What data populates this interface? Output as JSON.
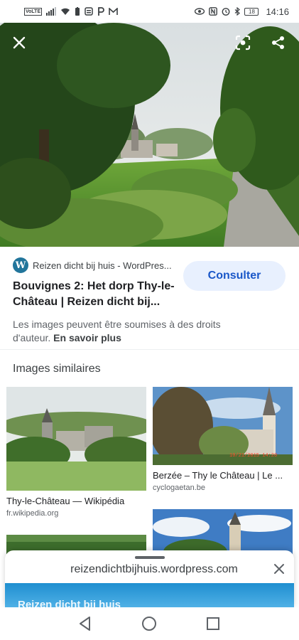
{
  "status_bar": {
    "volte": "VoLTE",
    "battery": "18",
    "time": "14:16"
  },
  "hero": {
    "close_icon": "close-icon",
    "lens_icon": "lens-icon",
    "share_icon": "share-icon"
  },
  "result": {
    "source": "Reizen dicht bij huis - WordPres...",
    "consult_label": "Consulter",
    "title": "Bouvignes 2: Het dorp Thy-le-Château | Reizen dicht bij...",
    "copyright_text": "Les images peuvent être soumises à des droits d'auteur.",
    "learn_more": "En savoir plus"
  },
  "similar": {
    "heading": "Images similaires",
    "cards": [
      {
        "title": "Thy-le-Château — Wikipédia",
        "domain": "fr.wikipedia.org"
      },
      {
        "title": "Berzée – Thy le Château | Le ...",
        "domain": "cyclogaetan.be"
      }
    ]
  },
  "sheet": {
    "url": "reizendichtbijhuis.wordpress.com",
    "preview_title": "Reizen dicht bij huis"
  },
  "colors": {
    "accent": "#1a57c8",
    "button_bg": "#e8f0fe",
    "wordpress": "#21759b"
  }
}
